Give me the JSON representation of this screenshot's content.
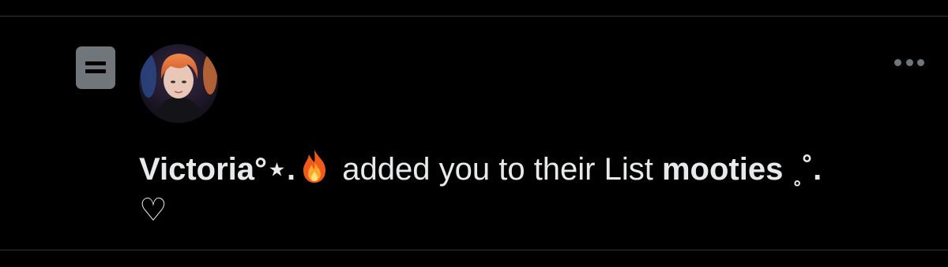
{
  "notification": {
    "user_name_part1": "Victoria°⋆.",
    "user_emoji": "fire",
    "action_text": " added you to their List ",
    "list_name": "mooties ",
    "list_name_trail": "˳˚.",
    "list_name_line2": "♡"
  },
  "icons": {
    "list": "list-icon",
    "more": "more-options-icon",
    "avatar": "user-avatar"
  },
  "colors": {
    "background": "#000000",
    "text": "#e7e9ea",
    "muted": "#71767b",
    "divider": "#2f3336"
  }
}
